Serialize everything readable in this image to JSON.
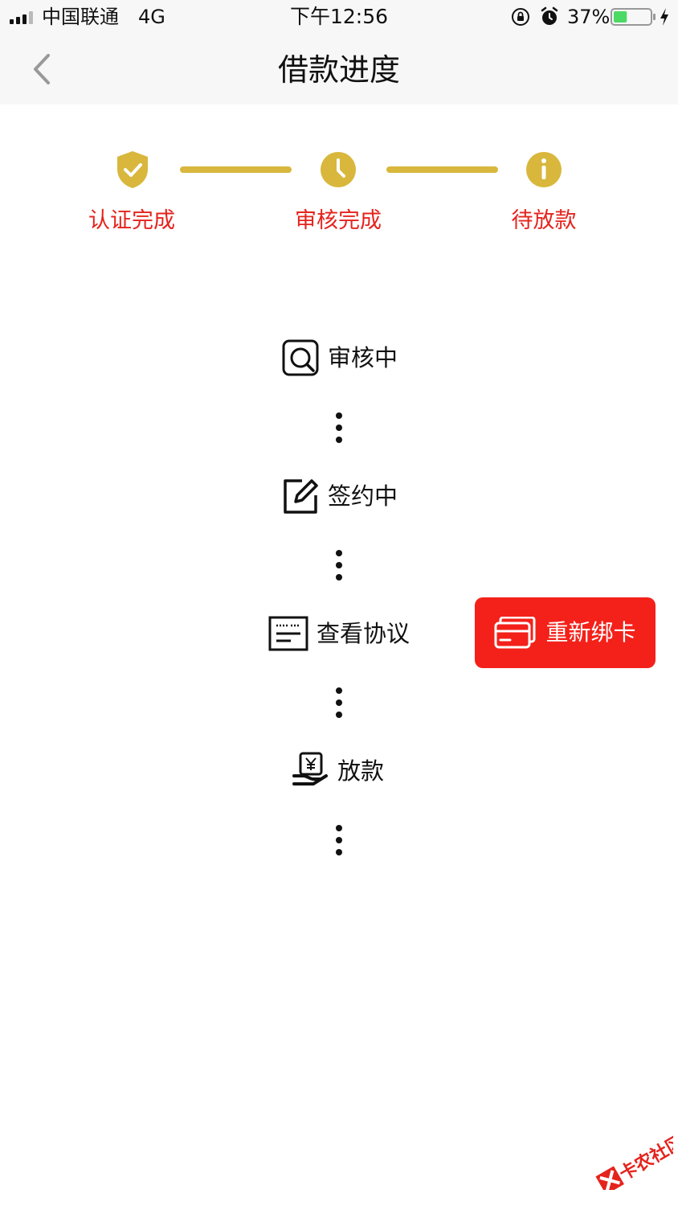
{
  "status_bar": {
    "carrier": "中国联通",
    "network": "4G",
    "time": "下午12:56",
    "battery_percent": "37%",
    "battery_level": 0.37
  },
  "nav": {
    "title": "借款进度",
    "back_icon": "chevron-left-icon"
  },
  "steps": [
    {
      "label": "认证完成",
      "icon": "shield-check-icon"
    },
    {
      "label": "审核完成",
      "icon": "clock-icon"
    },
    {
      "label": "待放款",
      "icon": "info-icon"
    }
  ],
  "process": [
    {
      "label": "审核中",
      "icon": "search-review-icon"
    },
    {
      "label": "签约中",
      "icon": "edit-sign-icon"
    },
    {
      "label": "查看协议",
      "icon": "agreement-doc-icon"
    },
    {
      "label": "放款",
      "icon": "hand-money-icon"
    }
  ],
  "rebind_button": {
    "label": "重新绑卡",
    "icon": "bank-card-icon"
  },
  "watermark": {
    "text": "卡农社区"
  },
  "colors": {
    "accent_gold": "#d8b73c",
    "step_label_red": "#e5231d",
    "button_red": "#f3211a"
  }
}
